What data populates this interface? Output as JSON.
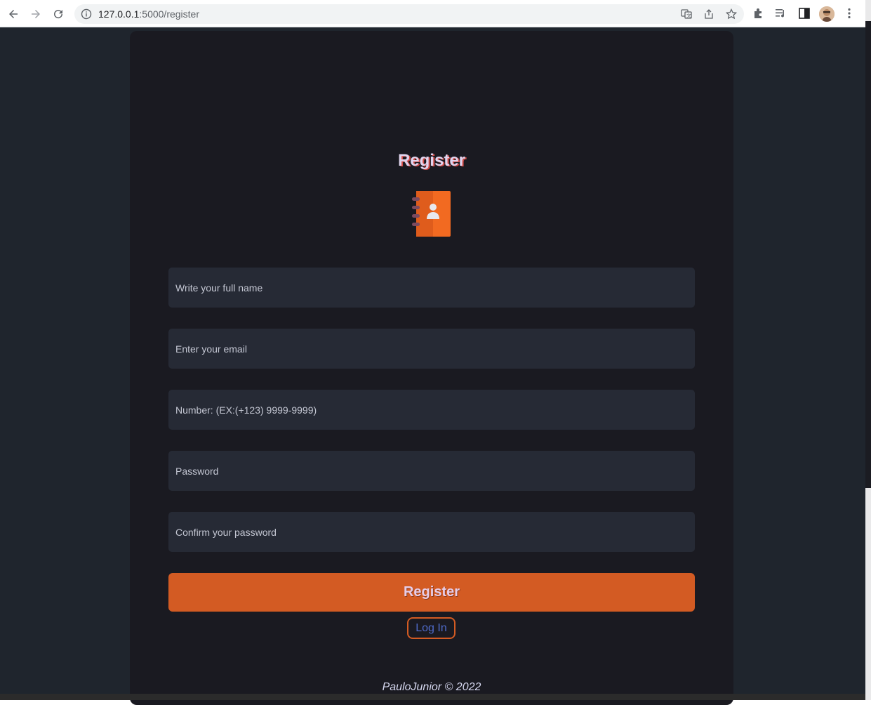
{
  "browser": {
    "url_host": "127.0.0.1",
    "url_path": ":5000/register"
  },
  "register": {
    "title": "Register",
    "fields": {
      "full_name_placeholder": "Write your full name",
      "email_placeholder": "Enter your email",
      "number_placeholder": "Number: (EX:(+123) 9999-9999)",
      "password_placeholder": "Password",
      "confirm_password_placeholder": "Confirm your password"
    },
    "submit_label": "Register",
    "login_label": "Log In"
  },
  "footer": {
    "text": "PauloJunior © 2022"
  },
  "colors": {
    "accent": "#d35b23",
    "card_background": "#1a1a21",
    "field_background": "#262a35",
    "link": "#4f6ac8"
  },
  "icons": {
    "logo": "contact-book-icon"
  }
}
